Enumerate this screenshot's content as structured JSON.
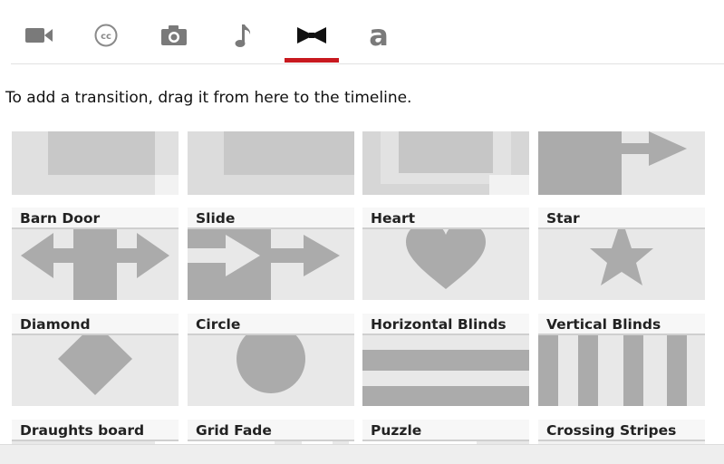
{
  "tabs": [
    {
      "name": "video-camera-icon",
      "active": false
    },
    {
      "name": "closed-captions-icon",
      "active": false
    },
    {
      "name": "camera-icon",
      "active": false
    },
    {
      "name": "music-note-icon",
      "active": false
    },
    {
      "name": "bow-tie-icon",
      "active": true
    },
    {
      "name": "text-a-icon",
      "active": false
    }
  ],
  "accent_color": "#c8191f",
  "instructions": "To add a transition, drag it from here to the timeline.",
  "transitions": [
    {
      "label": "Barn Door",
      "icon": "barn-door-preview"
    },
    {
      "label": "Slide",
      "icon": "slide-preview"
    },
    {
      "label": "Heart",
      "icon": "heart-preview"
    },
    {
      "label": "Star",
      "icon": "star-preview"
    },
    {
      "label": "Diamond",
      "icon": "diamond-preview"
    },
    {
      "label": "Circle",
      "icon": "circle-preview"
    },
    {
      "label": "Horizontal Blinds",
      "icon": "horizontal-blinds-preview"
    },
    {
      "label": "Vertical Blinds",
      "icon": "vertical-blinds-preview"
    },
    {
      "label": "Draughts board",
      "icon": "draughts-board-preview"
    },
    {
      "label": "Grid Fade",
      "icon": "grid-fade-preview"
    },
    {
      "label": "Puzzle",
      "icon": "puzzle-preview"
    },
    {
      "label": "Crossing Stripes",
      "icon": "crossing-stripes-preview"
    }
  ]
}
